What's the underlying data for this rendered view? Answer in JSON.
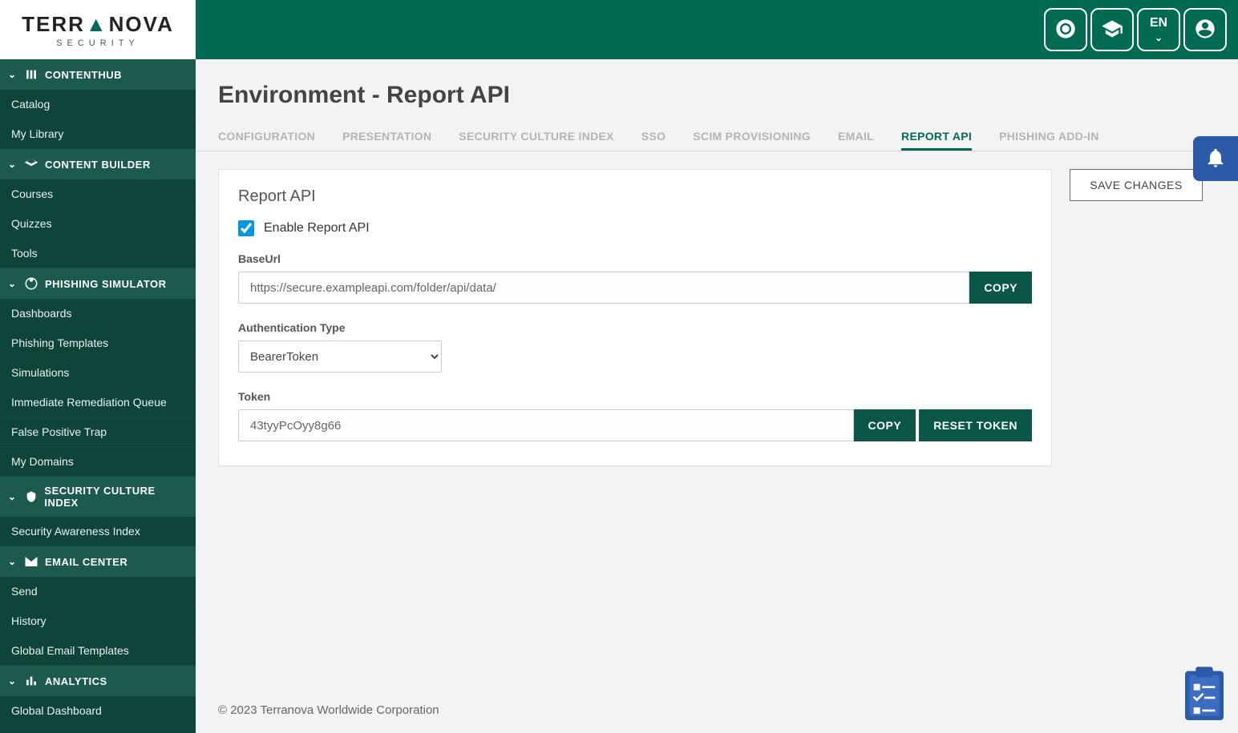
{
  "brand": {
    "name_a": "TERR",
    "name_b": "NOVA",
    "sub": "SECURITY"
  },
  "header": {
    "lang": "EN"
  },
  "sidebar": {
    "sections": [
      {
        "label": "CONTENTHUB",
        "items": [
          "Catalog",
          "My Library"
        ]
      },
      {
        "label": "CONTENT BUILDER",
        "items": [
          "Courses",
          "Quizzes",
          "Tools"
        ]
      },
      {
        "label": "PHISHING SIMULATOR",
        "items": [
          "Dashboards",
          "Phishing Templates",
          "Simulations",
          "Immediate Remediation Queue",
          "False Positive Trap",
          "My Domains"
        ]
      },
      {
        "label": "SECURITY CULTURE INDEX",
        "items": [
          "Security Awareness Index"
        ]
      },
      {
        "label": "EMAIL CENTER",
        "items": [
          "Send",
          "History",
          "Global Email Templates"
        ]
      },
      {
        "label": "ANALYTICS",
        "items": [
          "Global Dashboard"
        ]
      }
    ]
  },
  "page": {
    "title": "Environment - Report API"
  },
  "tabs": [
    "CONFIGURATION",
    "PRESENTATION",
    "SECURITY CULTURE INDEX",
    "SSO",
    "SCIM PROVISIONING",
    "EMAIL",
    "REPORT API",
    "PHISHING ADD-IN"
  ],
  "active_tab": "REPORT API",
  "actions": {
    "save": "SAVE CHANGES"
  },
  "card": {
    "title": "Report API",
    "enable_label": "Enable Report API",
    "enable_checked": true,
    "baseurl_label": "BaseUrl",
    "baseurl_value": "https://secure.exampleapi.com/folder/api/data/",
    "copy": "COPY",
    "authtype_label": "Authentication Type",
    "authtype_value": "BearerToken",
    "token_label": "Token",
    "token_value": "43tyyPcOyy8g66",
    "reset_token": "RESET TOKEN"
  },
  "footer": {
    "copyright": "© 2023 Terranova Worldwide Corporation"
  }
}
